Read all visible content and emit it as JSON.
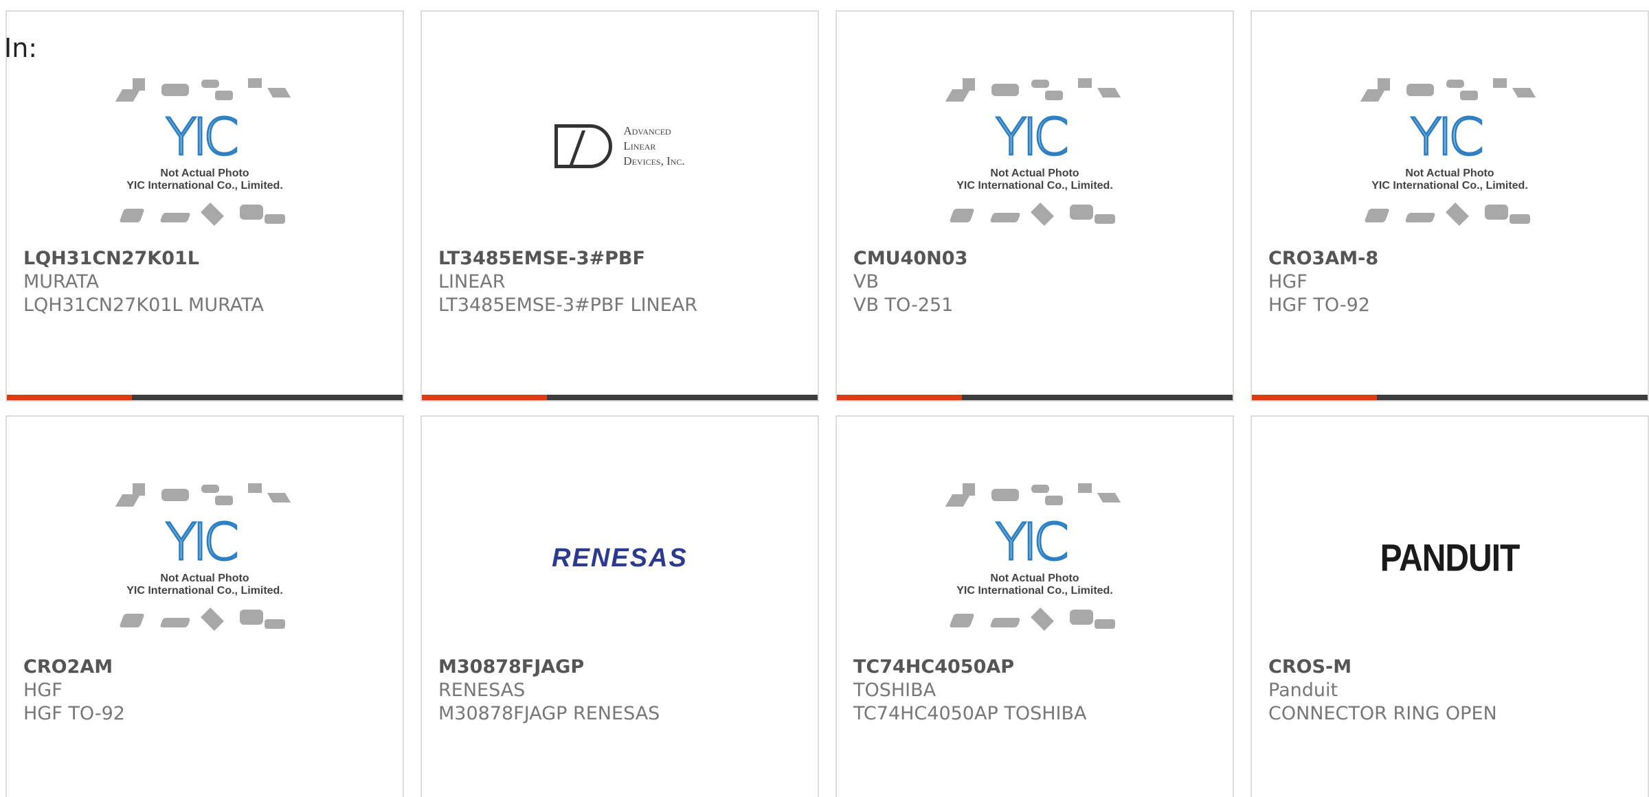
{
  "header": {
    "label": "In:"
  },
  "products": [
    {
      "part_number": "LQH31CN27K01L",
      "manufacturer": "MURATA",
      "description": "LQH31CN27K01L MURATA",
      "image": "yic-placeholder"
    },
    {
      "part_number": "LT3485EMSE-3#PBF",
      "manufacturer": "LINEAR",
      "description": "LT3485EMSE-3#PBF LINEAR",
      "image": "advanced-linear-devices-logo"
    },
    {
      "part_number": "CMU40N03",
      "manufacturer": "VB",
      "description": "VB TO-251",
      "image": "yic-placeholder"
    },
    {
      "part_number": "CRO3AM-8",
      "manufacturer": "HGF",
      "description": "HGF TO-92",
      "image": "yic-placeholder"
    },
    {
      "part_number": "CRO2AM",
      "manufacturer": "HGF",
      "description": "HGF TO-92",
      "image": "yic-placeholder"
    },
    {
      "part_number": "M30878FJAGP",
      "manufacturer": "RENESAS",
      "description": "M30878FJAGP RENESAS",
      "image": "renesas-logo"
    },
    {
      "part_number": "TC74HC4050AP",
      "manufacturer": "TOSHIBA",
      "description": "TC74HC4050AP TOSHIBA",
      "image": "yic-placeholder"
    },
    {
      "part_number": "CROS-M",
      "manufacturer": "Panduit",
      "description": "CONNECTOR RING OPEN",
      "image": "panduit-logo"
    }
  ],
  "placeholder": {
    "logo_text": "YIC",
    "line1": "Not Actual Photo",
    "line2": "YIC International Co., Limited."
  },
  "brand_logos": {
    "ald_line1": "Advanced",
    "ald_line2": "Linear",
    "ald_line3": "Devices, Inc.",
    "renesas": "RENESAS",
    "panduit": "PANDUIT"
  },
  "colors": {
    "accent": "#e03a12",
    "bar": "#3d3d3d",
    "border": "#dddddd",
    "yic_blue": "#2b7fc2",
    "renesas_blue": "#2b3a8f"
  }
}
